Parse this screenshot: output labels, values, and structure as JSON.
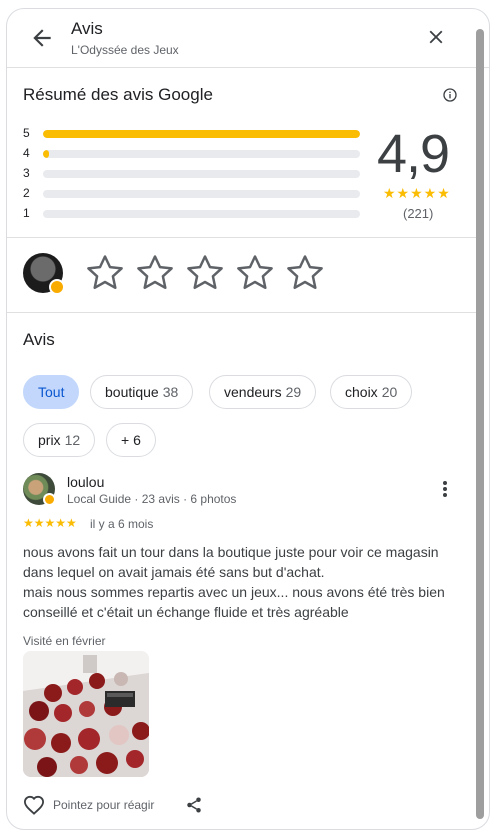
{
  "header": {
    "title": "Avis",
    "subtitle": "L'Odyssée des Jeux"
  },
  "summary": {
    "title": "Résumé des avis Google",
    "rows": [
      {
        "star": "5",
        "fraction": 1.0
      },
      {
        "star": "4",
        "fraction": 0.02
      },
      {
        "star": "3",
        "fraction": 0.0
      },
      {
        "star": "2",
        "fraction": 0.0
      },
      {
        "star": "1",
        "fraction": 0.0
      }
    ],
    "rating": "4,9",
    "stars": "★★★★★",
    "count": "(221)",
    "bar_color": "#fbbc04"
  },
  "rate": {
    "star_count": 5
  },
  "reviews_section": {
    "title": "Avis",
    "chips": [
      {
        "label": "Tout",
        "count": ""
      },
      {
        "label": "boutique",
        "count": "38"
      },
      {
        "label": "vendeurs",
        "count": "29"
      },
      {
        "label": "choix",
        "count": "20"
      },
      {
        "label": "prix",
        "count": "12"
      },
      {
        "label": "+ 6",
        "count": ""
      }
    ],
    "active_chip": "Tout",
    "active_color": "#c2d7fb"
  },
  "review": {
    "name": "loulou",
    "meta": "Local Guide · 23 avis · 6 photos",
    "stars": "★★★★★",
    "date": "il y a 6 mois",
    "text_lines": [
      "nous avons fait un tour dans la boutique juste pour voir ce magasin dans lequel on avait jamais été sans but d'achat.",
      "mais nous sommes repartis avec un jeux... nous avons été très bien conseillé et c'était un échange fluide et très agréable"
    ],
    "visited": "Visité en février",
    "like_label": "Pointez pour réagir"
  },
  "icons": {
    "back": "arrow-back-icon",
    "close": "close-icon",
    "info": "info-icon",
    "more": "more-vert-icon",
    "like": "heart-icon",
    "share": "share-icon"
  }
}
